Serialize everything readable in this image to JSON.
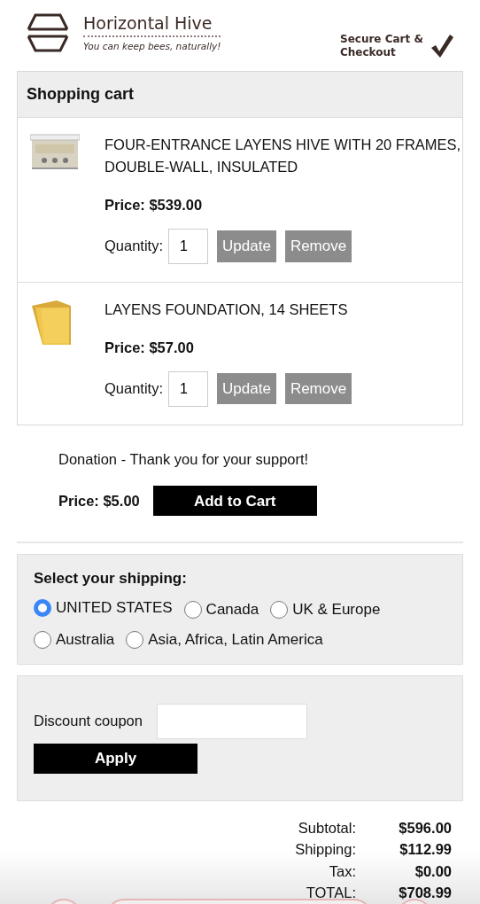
{
  "header": {
    "brand": "Horizontal Hive",
    "tagline": "You can keep bees, naturally!",
    "secure": "Secure Cart & Checkout"
  },
  "cart": {
    "title": "Shopping cart",
    "items": [
      {
        "name": "FOUR-ENTRANCE LAYENS HIVE WITH 20 FRAMES, DOUBLE-WALL, INSULATED",
        "price": "Price: $539.00",
        "quantity_label": "Quantity:",
        "quantity": "1",
        "update": "Update",
        "remove": "Remove",
        "kind": "picture"
      },
      {
        "name": "LAYENS FOUNDATION, 14 SHEETS",
        "price": "Price: $57.00",
        "quantity_label": "Quantity:",
        "quantity": "1",
        "update": "Update",
        "remove": "Remove",
        "kind": "picture"
      }
    ]
  },
  "donation": {
    "text": "Donation - Thank you for your support!",
    "price": "Price: $5.00",
    "button": "Add to Cart"
  },
  "shipping": {
    "title": "Select your shipping:",
    "options": [
      {
        "label": "UNITED STATES",
        "selected": true
      },
      {
        "label": "Canada",
        "selected": false
      },
      {
        "label": "UK & Europe",
        "selected": false
      },
      {
        "label": "Australia",
        "selected": false
      },
      {
        "label": "Asia, Africa, Latin America",
        "selected": false
      }
    ]
  },
  "coupon": {
    "label": "Discount coupon",
    "button": "Apply"
  },
  "totals": [
    {
      "label": "Subtotal:",
      "value": "$596.00"
    },
    {
      "label": "Shipping:",
      "value": "$112.99"
    },
    {
      "label": "Tax:",
      "value": "$0.00"
    },
    {
      "label": "TOTAL:",
      "value": "$708.99"
    }
  ]
}
